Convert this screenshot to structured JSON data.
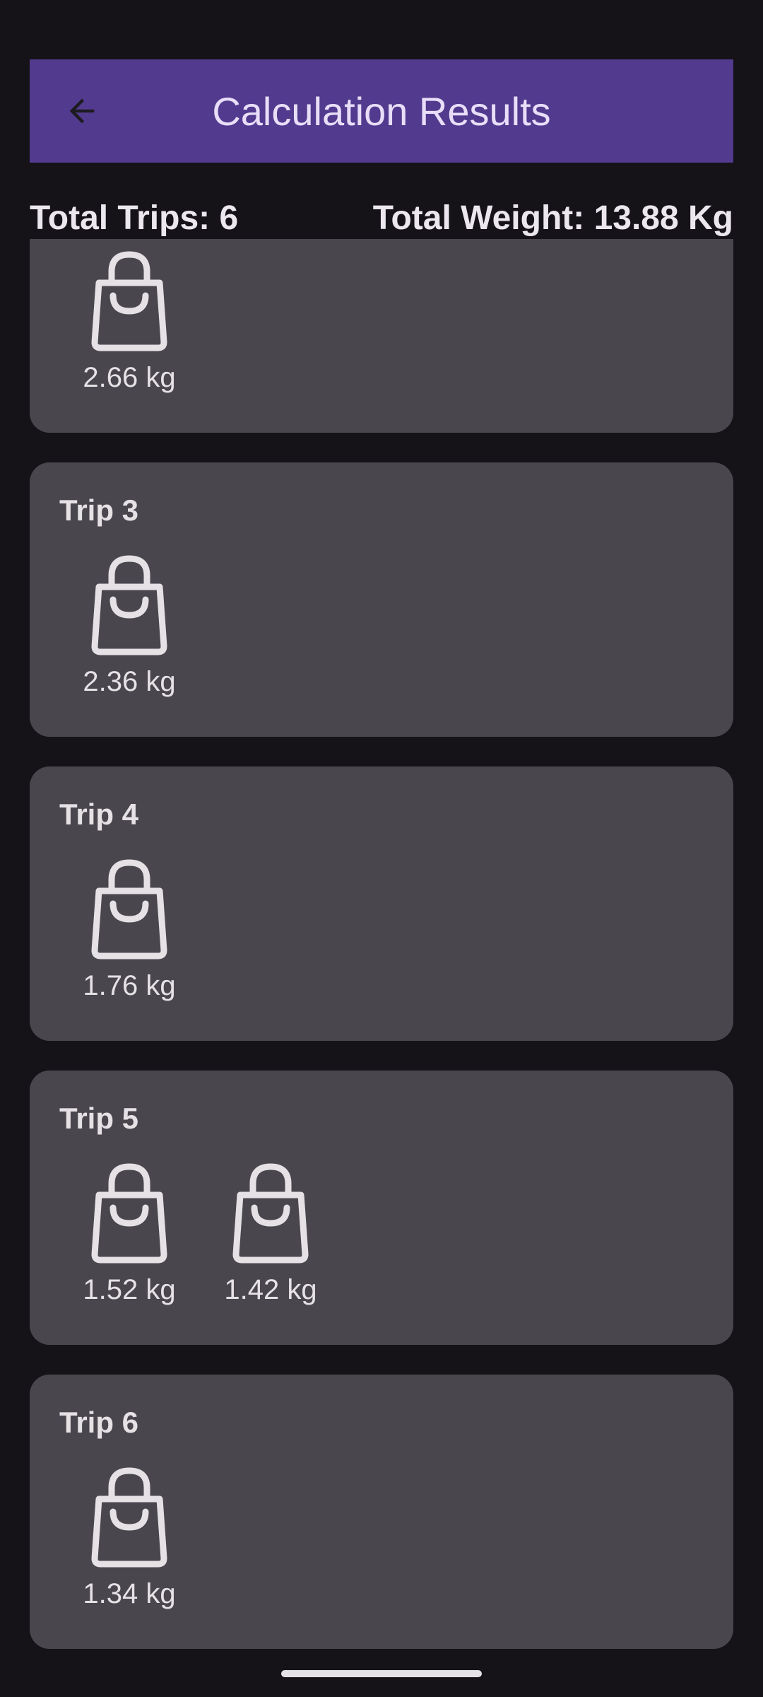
{
  "header": {
    "title": "Calculation Results",
    "back_icon": "arrow-back-icon"
  },
  "summary": {
    "total_trips": "Total Trips: 6",
    "total_weight": "Total Weight: 13.88 Kg"
  },
  "trips": [
    {
      "title": "",
      "bags": [
        "2.66 kg"
      ]
    },
    {
      "title": "Trip 3",
      "bags": [
        "2.36 kg"
      ]
    },
    {
      "title": "Trip 4",
      "bags": [
        "1.76 kg"
      ]
    },
    {
      "title": "Trip 5",
      "bags": [
        "1.52 kg",
        "1.42 kg"
      ]
    },
    {
      "title": "Trip 6",
      "bags": [
        "1.34 kg"
      ]
    }
  ],
  "bag_icon": "shopping-bag-icon",
  "colors": {
    "app_bar": "#523a8e",
    "background": "#151318",
    "card": "#49464e",
    "text": "#e6e1e5"
  }
}
